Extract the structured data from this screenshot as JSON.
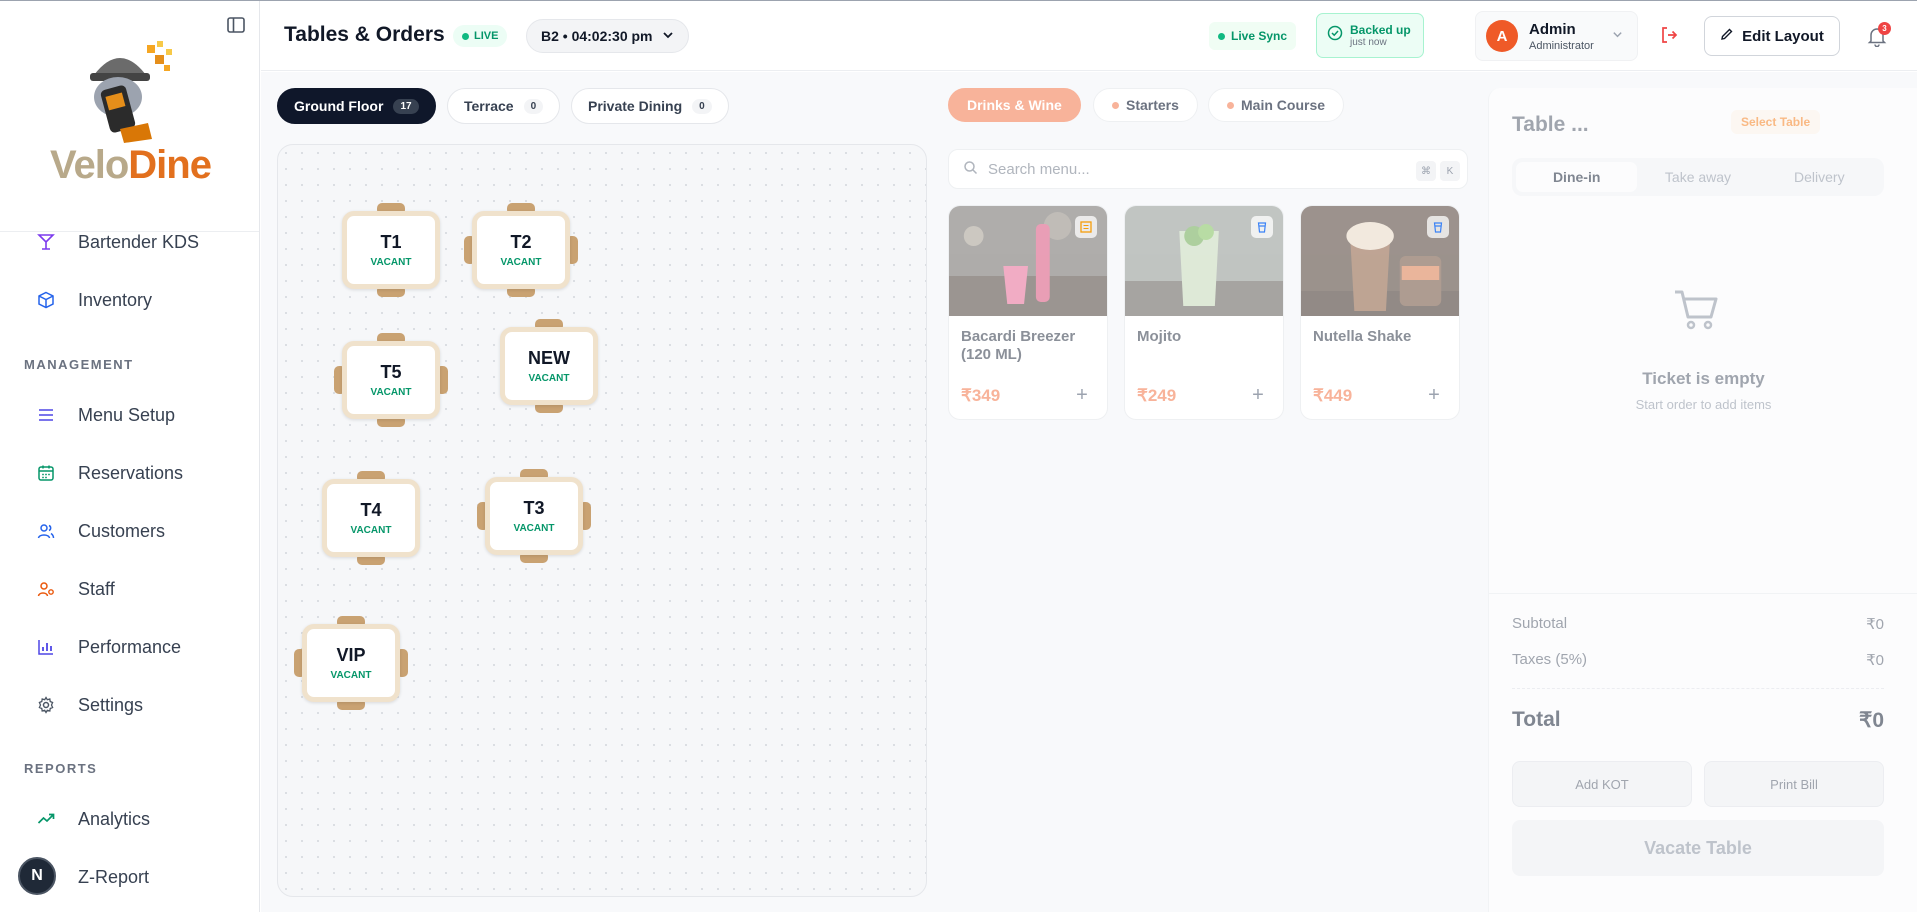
{
  "brand": {
    "word_a": "Velo",
    "word_b": "Dine"
  },
  "sidebar": {
    "items_top": [
      {
        "label": "Bartender KDS",
        "icon": "cocktail-icon"
      },
      {
        "label": "Inventory",
        "icon": "box-icon"
      }
    ],
    "section_management": "MANAGEMENT",
    "items_management": [
      {
        "label": "Menu Setup",
        "icon": "menu-list-icon"
      },
      {
        "label": "Reservations",
        "icon": "calendar-icon"
      },
      {
        "label": "Customers",
        "icon": "users-icon"
      },
      {
        "label": "Staff",
        "icon": "staff-icon"
      },
      {
        "label": "Performance",
        "icon": "bar-chart-icon"
      },
      {
        "label": "Settings",
        "icon": "gear-icon"
      }
    ],
    "section_reports": "REPORTS",
    "items_reports": [
      {
        "label": "Analytics",
        "icon": "trend-icon"
      },
      {
        "label": "Z-Report",
        "icon": "report-icon"
      }
    ],
    "n_badge": "N"
  },
  "header": {
    "title": "Tables & Orders",
    "live": "LIVE",
    "session": "B2 • 04:02:30 pm",
    "live_sync": "Live Sync",
    "backed_up": "Backed up",
    "backed_up_time": "just now",
    "user_initial": "A",
    "user_name": "Admin",
    "user_role": "Administrator",
    "edit_layout": "Edit Layout",
    "notif_count": "3"
  },
  "floors": [
    {
      "label": "Ground Floor",
      "count": "17",
      "active": true
    },
    {
      "label": "Terrace",
      "count": "0",
      "active": false
    },
    {
      "label": "Private Dining",
      "count": "0",
      "active": false
    }
  ],
  "tables": [
    {
      "name": "T1",
      "status": "VACANT"
    },
    {
      "name": "T2",
      "status": "VACANT"
    },
    {
      "name": "T5",
      "status": "VACANT"
    },
    {
      "name": "NEW",
      "status": "VACANT"
    },
    {
      "name": "T4",
      "status": "VACANT"
    },
    {
      "name": "T3",
      "status": "VACANT"
    },
    {
      "name": "VIP",
      "status": "VACANT"
    }
  ],
  "categories": [
    {
      "label": "Drinks & Wine",
      "active": true
    },
    {
      "label": "Starters",
      "active": false
    },
    {
      "label": "Main Course",
      "active": false
    }
  ],
  "search": {
    "placeholder": "Search menu...",
    "kbd1": "⌘",
    "kbd2": "K"
  },
  "menu_items": [
    {
      "name": "Bacardi Breezer (120 ML)",
      "price": "₹349",
      "type": "veg"
    },
    {
      "name": "Mojito",
      "price": "₹249",
      "type": "drink"
    },
    {
      "name": "Nutella Shake",
      "price": "₹449",
      "type": "drink"
    }
  ],
  "ticket": {
    "title": "Table ...",
    "select_table": "Select Table",
    "order_types": [
      "Dine-in",
      "Take away",
      "Delivery"
    ],
    "empty_title": "Ticket is empty",
    "empty_sub": "Start order to add items",
    "subtotal_label": "Subtotal",
    "subtotal": "₹0",
    "taxes_label": "Taxes (5%)",
    "taxes": "₹0",
    "total_label": "Total",
    "total": "₹0",
    "add_kot": "Add KOT",
    "print_bill": "Print Bill",
    "vacate": "Vacate Table"
  },
  "colors": {
    "accent": "#ef5a28",
    "success": "#059669",
    "dark": "#0f172a",
    "chair": "#c9a272",
    "category_active": "#f8b39a"
  }
}
